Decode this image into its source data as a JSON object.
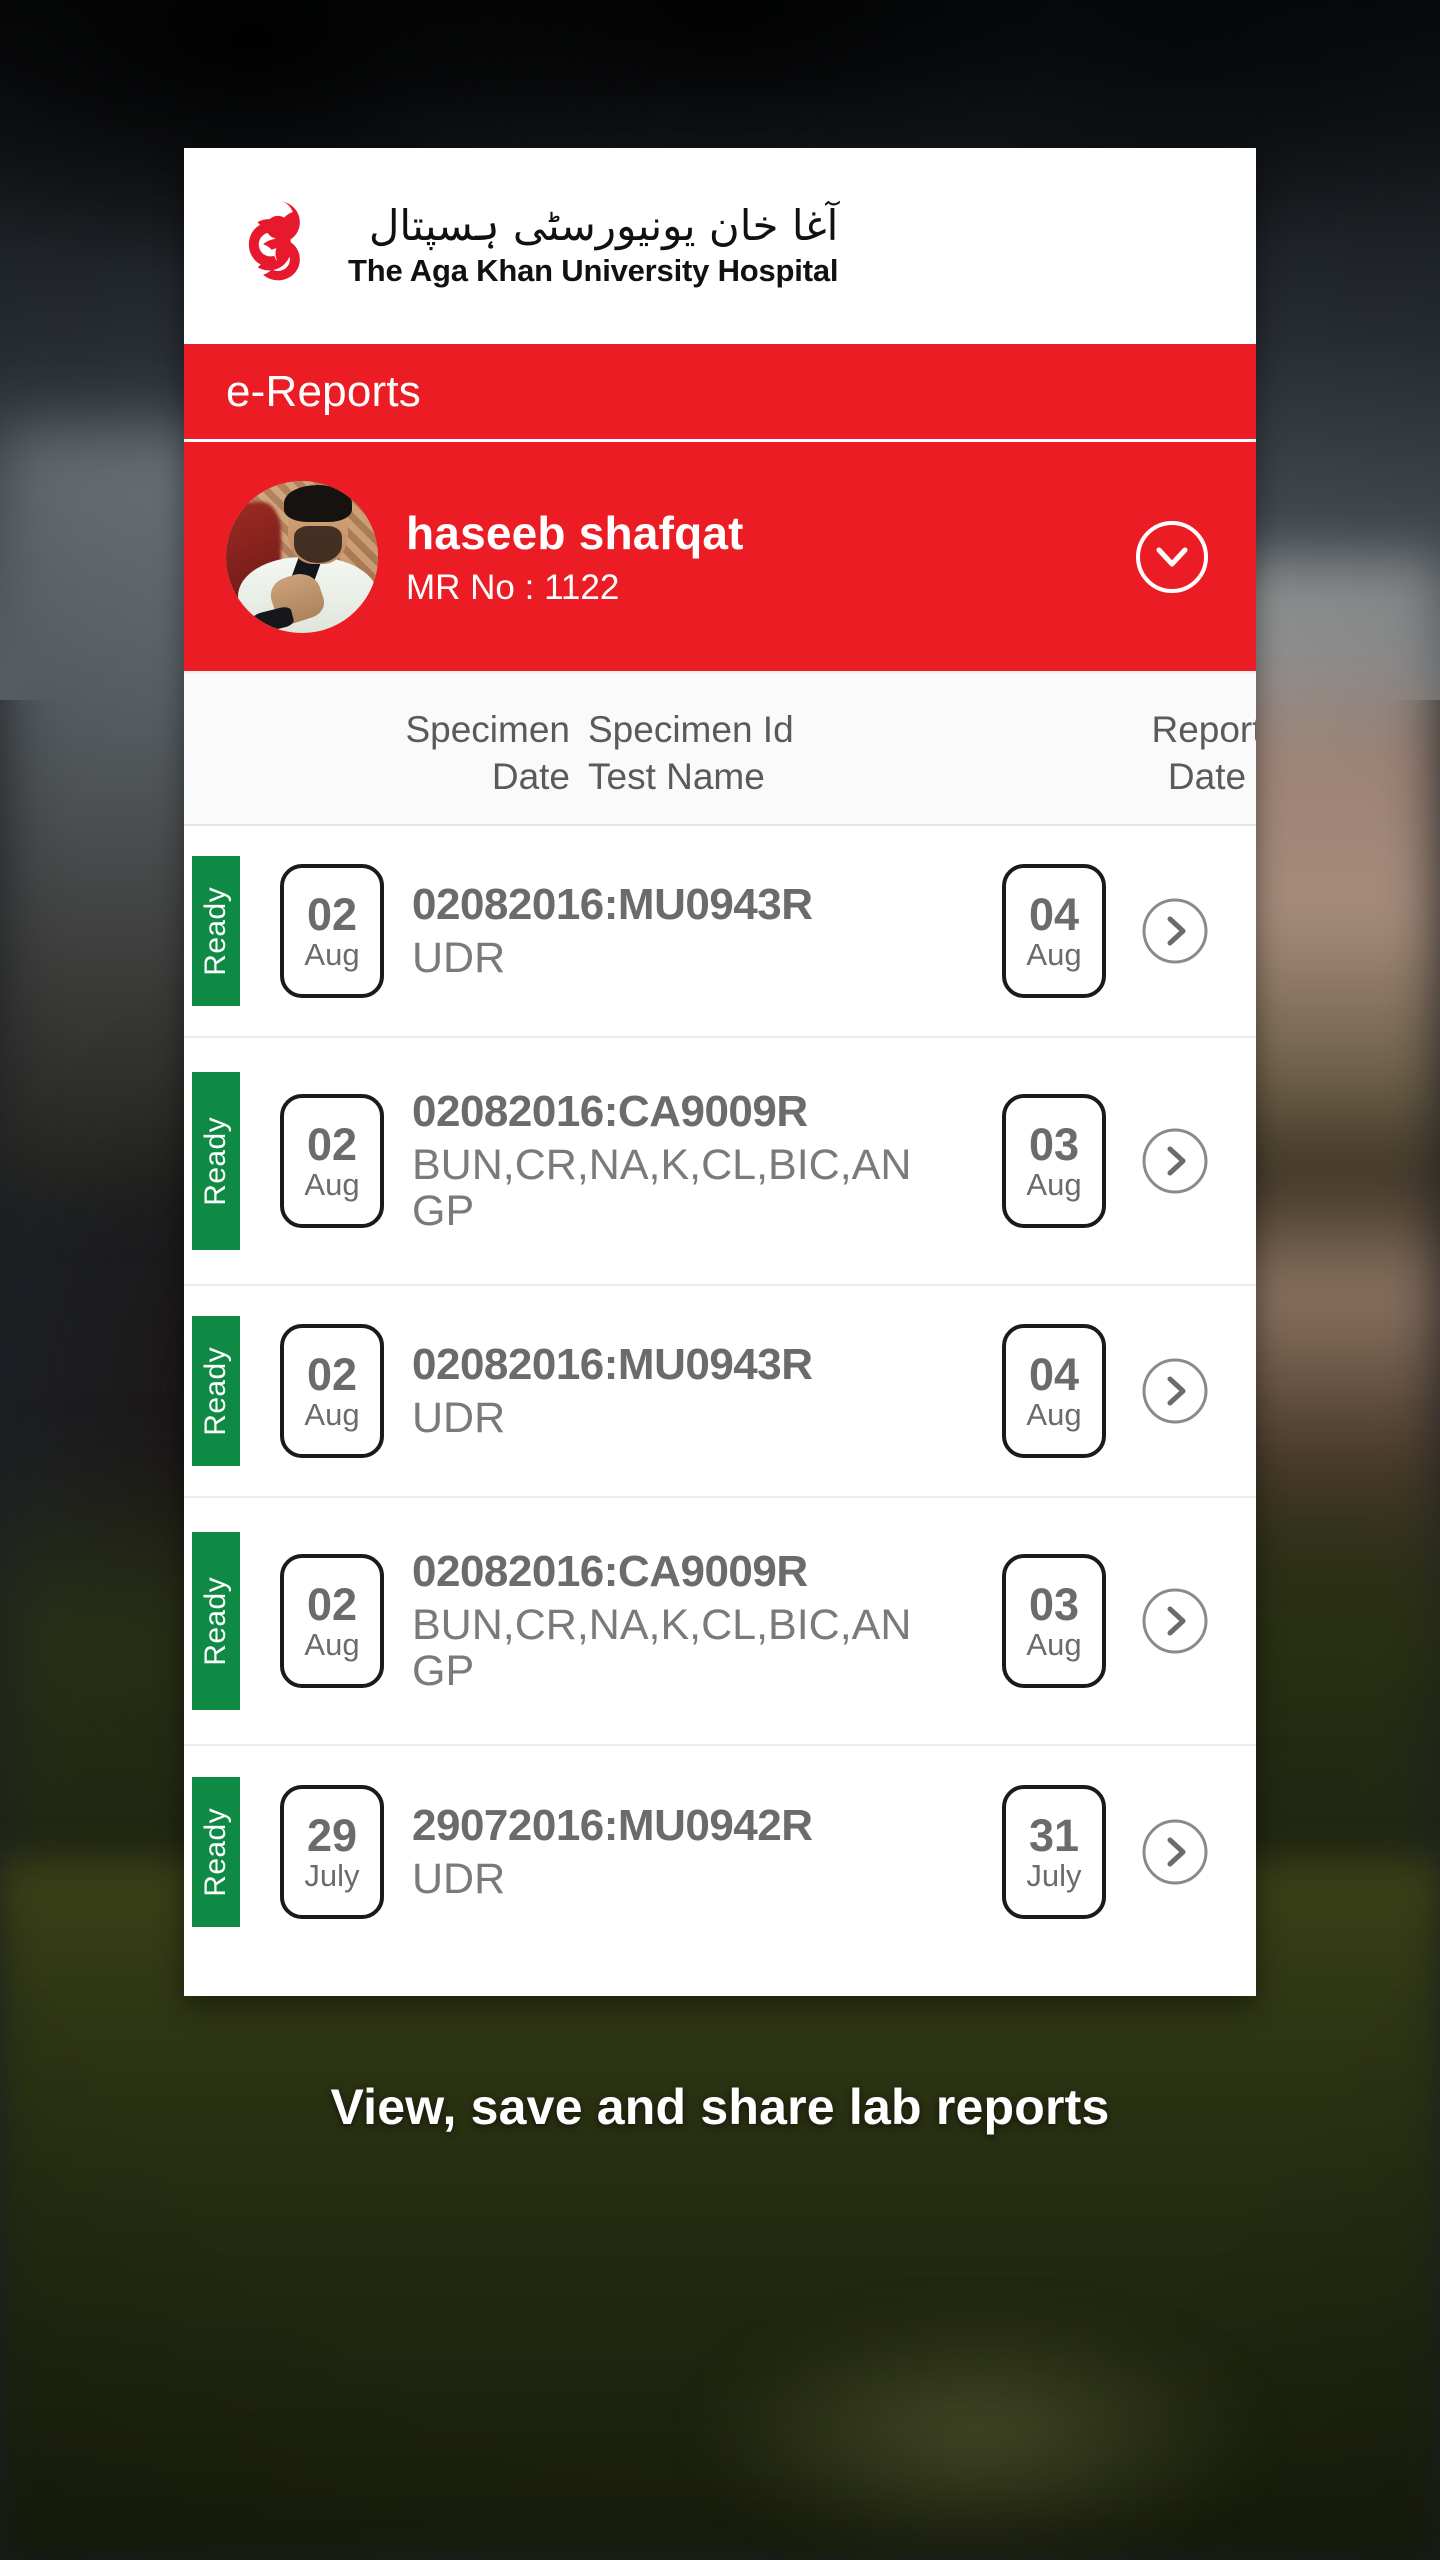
{
  "brand": {
    "urdu_name": "آغا خان یونیورسٹی ہسپتال",
    "english_name": "The Aga Khan University Hospital",
    "logo_icon": "aga-khan-trefoil-logo",
    "add_icon": "plus-icon",
    "accent_red": "#ec1c24",
    "status_green": "#0f8a45"
  },
  "title_bar": {
    "label": "e-Reports"
  },
  "patient": {
    "name": "haseeb shafqat",
    "mr_label": "MR No : 1122",
    "avatar_icon": "user-avatar",
    "expand_icon": "chevron-down-icon"
  },
  "table": {
    "headers": {
      "specimen_line1": "Specimen",
      "specimen_line2": "Date",
      "testname_line1": "Specimen Id",
      "testname_line2": "Test Name",
      "report_line1": "Report",
      "report_line2": "Date"
    },
    "rows": [
      {
        "status": "Ready",
        "specimen_day": "02",
        "specimen_month": "Aug",
        "specimen_id": "02082016:MU0943R",
        "test_name": "UDR",
        "report_day": "04",
        "report_month": "Aug",
        "open_icon": "chevron-right-icon"
      },
      {
        "status": "Ready",
        "specimen_day": "02",
        "specimen_month": "Aug",
        "specimen_id": "02082016:CA9009R",
        "test_name": "BUN,CR,NA,K,CL,BIC,ANGP",
        "report_day": "03",
        "report_month": "Aug",
        "open_icon": "chevron-right-icon"
      },
      {
        "status": "Ready",
        "specimen_day": "02",
        "specimen_month": "Aug",
        "specimen_id": "02082016:MU0943R",
        "test_name": "UDR",
        "report_day": "04",
        "report_month": "Aug",
        "open_icon": "chevron-right-icon"
      },
      {
        "status": "Ready",
        "specimen_day": "02",
        "specimen_month": "Aug",
        "specimen_id": "02082016:CA9009R",
        "test_name": "BUN,CR,NA,K,CL,BIC,ANGP",
        "report_day": "03",
        "report_month": "Aug",
        "open_icon": "chevron-right-icon"
      },
      {
        "status": "Ready",
        "specimen_day": "29",
        "specimen_month": "July",
        "specimen_id": "29072016:MU0942R",
        "test_name": "UDR",
        "report_day": "31",
        "report_month": "July",
        "open_icon": "chevron-right-icon"
      }
    ]
  },
  "caption": {
    "text": "View, save and share lab reports"
  }
}
